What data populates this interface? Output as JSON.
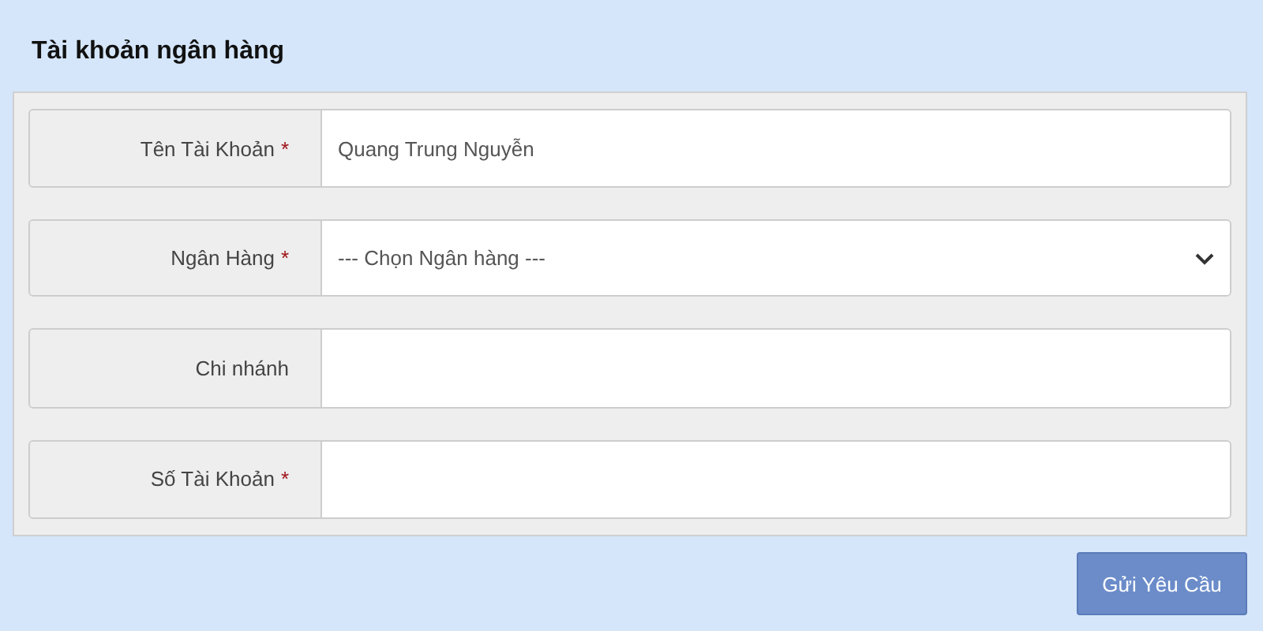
{
  "title": "Tài khoản ngân hàng",
  "fields": [
    {
      "label": "Tên Tài Khoản",
      "mark": "*",
      "kind": "input",
      "value": "Quang Trung Nguyễn"
    },
    {
      "label": "Ngân Hàng",
      "mark": "*",
      "kind": "select",
      "value": "--- Chọn Ngân hàng ---"
    },
    {
      "label": "Chi nhánh",
      "kind": "input"
    },
    {
      "label": "Số Tài Khoản",
      "mark": "*",
      "kind": "input"
    }
  ],
  "submit_button": "Gửi Yêu Cầu"
}
